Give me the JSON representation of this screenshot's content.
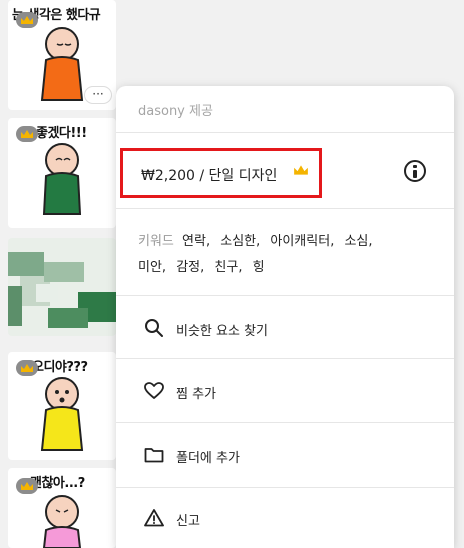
{
  "thumbnails": [
    {
      "caption": "는 생각은 했다규",
      "premium": true
    },
    {
      "caption": "좋겠다!!!",
      "premium": true
    },
    {
      "caption": "",
      "premium": false
    },
    {
      "caption": "오디야???",
      "premium": true
    },
    {
      "caption": "괜찮아...?",
      "premium": true
    }
  ],
  "more_button_label": "···",
  "menu": {
    "provider": "dasony 제공",
    "price": "₩2,200 / 단일 디자인",
    "keywords_label": "키워드",
    "keywords_line1": [
      "연락,",
      "소심한,",
      "아이캐릭터,",
      "소심,"
    ],
    "keywords_line2": [
      "미안,",
      "감정,",
      "친구,",
      "힝"
    ],
    "items": [
      {
        "label": "비슷한 요소 찾기",
        "icon": "search-icon"
      },
      {
        "label": "찜 추가",
        "icon": "heart-icon"
      },
      {
        "label": "폴더에 추가",
        "icon": "folder-icon"
      },
      {
        "label": "신고",
        "icon": "warning-icon"
      }
    ]
  },
  "colors": {
    "highlight": "#e4181b",
    "crown": "#f4b400",
    "badge": "#8c8c8c"
  }
}
